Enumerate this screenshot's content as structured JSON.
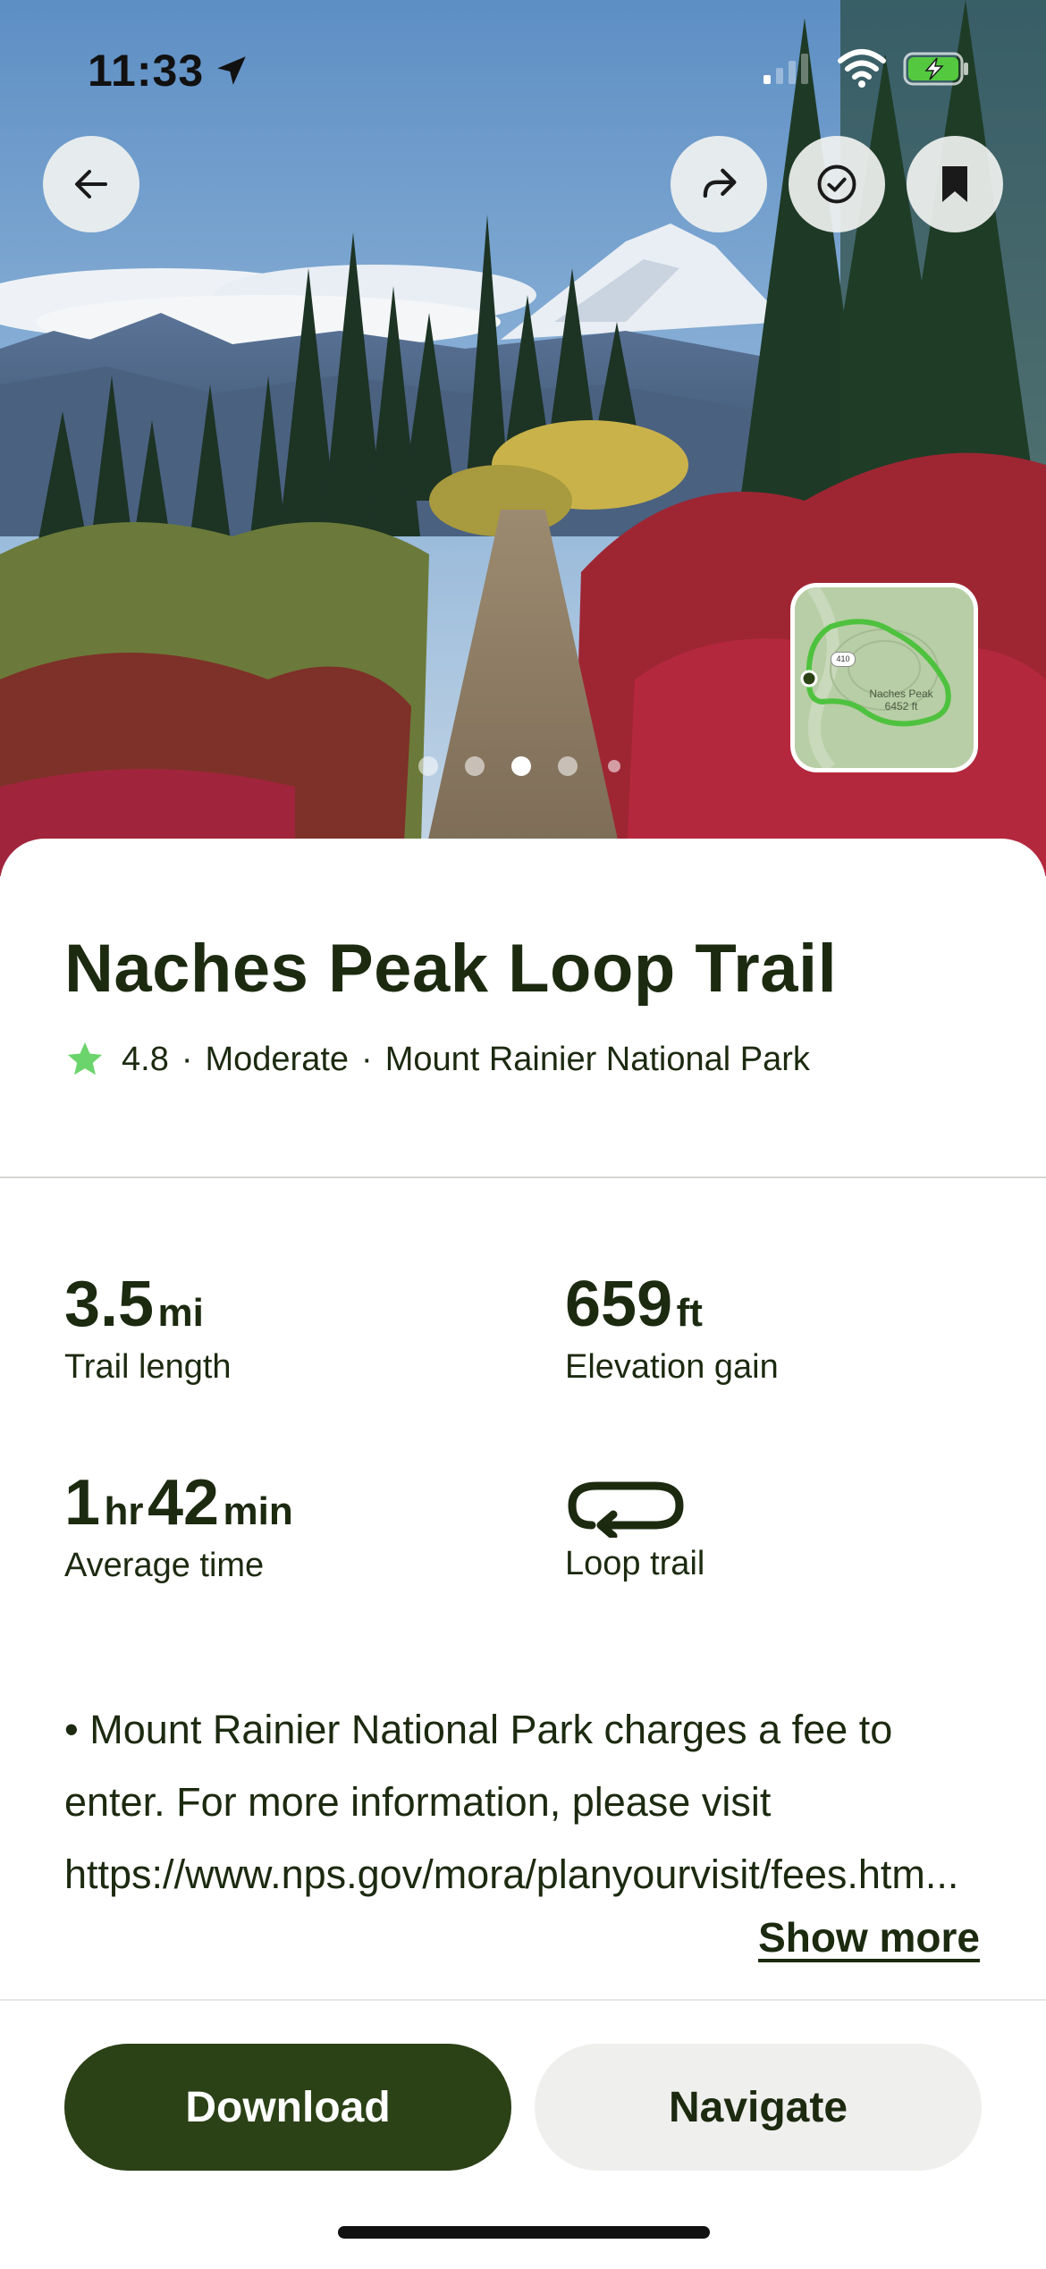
{
  "status_bar": {
    "time": "11:33"
  },
  "hero": {
    "photo_count": 5,
    "active_photo_index": 3,
    "map_thumbnail": {
      "road_shield": "410",
      "peak_name": "Naches Peak",
      "peak_elevation": "6452 ft"
    }
  },
  "trail": {
    "title": "Naches Peak Loop Trail",
    "rating": "4.8",
    "difficulty": "Moderate",
    "park": "Mount Rainier National Park",
    "separator": "·"
  },
  "stats": {
    "length": {
      "value": "3.5",
      "unit": "mi",
      "label": "Trail length"
    },
    "elevation": {
      "value": "659",
      "unit": "ft",
      "label": "Elevation gain"
    },
    "time": {
      "hours": "1",
      "hours_unit": "hr",
      "minutes": "42",
      "minutes_unit": "min",
      "label": "Average time"
    },
    "route_type": {
      "label": "Loop trail",
      "icon": "loop-icon"
    }
  },
  "description": {
    "text": "• Mount Rainier National Park charges a fee to enter. For more information, please visit https://www.nps.gov/mora/planyourvisit/fees.htm...",
    "show_more": "Show more"
  },
  "actions": {
    "download": "Download",
    "navigate": "Navigate"
  },
  "icons": {
    "back": "back-arrow-icon",
    "share": "share-icon",
    "completed": "check-circle-icon",
    "save": "bookmark-icon",
    "rating": "star-icon"
  },
  "colors": {
    "primary_button": "#2b4116",
    "secondary_button": "#efefed",
    "text": "#1c2a10",
    "rating_star": "#6cd46c",
    "map_route": "#4ec23e"
  }
}
